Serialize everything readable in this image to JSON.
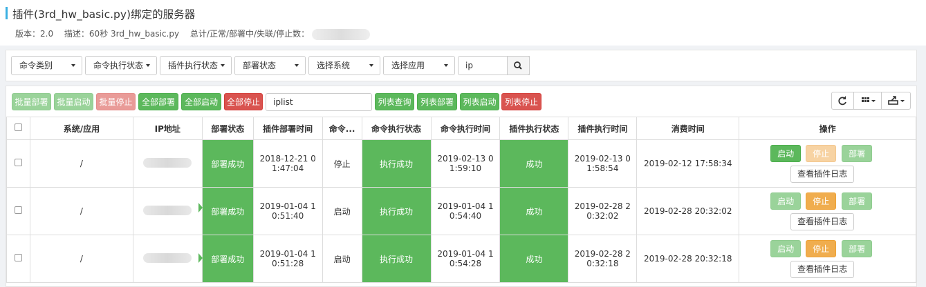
{
  "header": {
    "title": "插件(3rd_hw_basic.py)绑定的服务器",
    "version": "版本：2.0",
    "description": "描述：60秒 3rd_hw_basic.py",
    "stats_label": "总计/正常/部署中/失联/停止数："
  },
  "filters": {
    "items": [
      "命令类别",
      "命令执行状态",
      "插件执行状态",
      "部署状态",
      "选择系统",
      "选择应用"
    ],
    "ip_value": "ip"
  },
  "toolbar": {
    "buttons": [
      "批量部署",
      "批量启动",
      "批量停止",
      "全部部署",
      "全部启动",
      "全部停止"
    ],
    "list_input": "iplist",
    "list_buttons": [
      "列表查询",
      "列表部署",
      "列表启动",
      "列表停止"
    ]
  },
  "table": {
    "headers": [
      "系统/应用",
      "IP地址",
      "部署状态",
      "插件部署时间",
      "命令...",
      "命令执行状态",
      "命令执行时间",
      "插件执行状态",
      "插件执行时间",
      "消费时间",
      "操作"
    ],
    "rows": [
      {
        "sys": "/",
        "deploy": "部署成功",
        "deploy_time": [
          "2018-12-21 0",
          "1:47:04"
        ],
        "cmd": "停止",
        "cmd_status": "执行成功",
        "cmd_time": [
          "2019-02-13 0",
          "1:59:10"
        ],
        "plugin_status": "成功",
        "plugin_time": [
          "2019-02-13 0",
          "1:58:54"
        ],
        "cost": "2019-02-12 17:58:34"
      },
      {
        "sys": "/",
        "deploy": "部署成功",
        "deploy_time": [
          "2019-01-04 1",
          "0:51:40"
        ],
        "cmd": "启动",
        "cmd_status": "执行成功",
        "cmd_time": [
          "2019-01-04 1",
          "0:54:40"
        ],
        "plugin_status": "成功",
        "plugin_time": [
          "2019-02-28 2",
          "0:32:02"
        ],
        "cost": "2019-02-28 20:32:02"
      },
      {
        "sys": "/",
        "deploy": "部署成功",
        "deploy_time": [
          "2019-01-04 1",
          "0:51:28"
        ],
        "cmd": "启动",
        "cmd_status": "执行成功",
        "cmd_time": [
          "2019-01-04 1",
          "0:54:28"
        ],
        "plugin_status": "成功",
        "plugin_time": [
          "2019-02-28 2",
          "0:32:18"
        ],
        "cost": "2019-02-28 20:32:18"
      }
    ],
    "ops": {
      "start": "启动",
      "stop": "停止",
      "deploy": "部署",
      "log": "查看插件日志"
    }
  },
  "colors": {
    "success": "#5cb85c",
    "danger": "#d9534f",
    "warning": "#f0ad4e",
    "accent": "#3ab0e2"
  }
}
